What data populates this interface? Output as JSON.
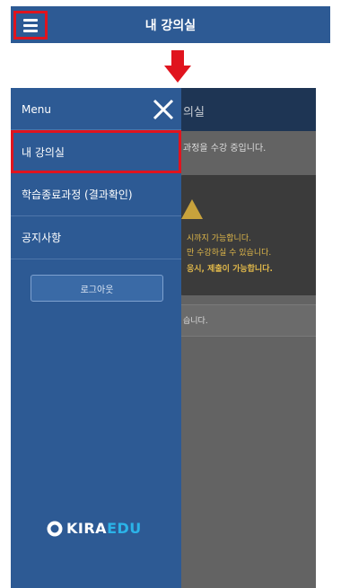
{
  "header": {
    "title": "내 강의실"
  },
  "background_page": {
    "title": "의실",
    "line1": "과정을 수강 중입니다.",
    "warning_line1": "시까지 가능합니다.",
    "warning_line2": "만 수강하실 수 있습니다.",
    "warning_line3": "응시, 제출이 가능합니다.",
    "card_text": "습니다."
  },
  "drawer": {
    "menu_label": "Menu",
    "items": [
      {
        "label": "내 강의실",
        "selected": true
      },
      {
        "label": "학습종료과정 (결과확인)",
        "selected": false
      },
      {
        "label": "공지사항",
        "selected": false
      }
    ],
    "logout_label": "로그아웃",
    "logo": {
      "prefix": "KIRA",
      "suffix": "EDU"
    }
  },
  "colors": {
    "header_blue": "#2d5a94",
    "highlight_red": "#e0141e",
    "arrow_red": "#e0141e",
    "logo_accent": "#2bb3e8",
    "warning_text": "#e0b84a"
  }
}
